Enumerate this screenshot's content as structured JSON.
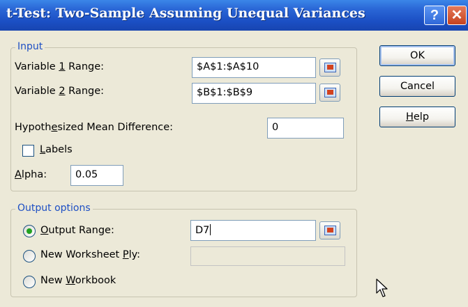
{
  "window": {
    "title": "t-Test: Two-Sample Assuming Unequal Variances",
    "help_glyph": "?",
    "close_glyph": "✕"
  },
  "input": {
    "legend": "Input",
    "var1": {
      "label_pre": "Variable ",
      "label_key": "1",
      "label_post": " Range:",
      "value": "$A$1:$A$10"
    },
    "var2": {
      "label_pre": "Variable ",
      "label_key": "2",
      "label_post": " Range:",
      "value": "$B$1:$B$9"
    },
    "hyp": {
      "label_pre": "Hypoth",
      "label_key": "e",
      "label_post": "sized Mean Difference:",
      "value": "0"
    },
    "labels": {
      "label_pre": "",
      "label_key": "L",
      "label_post": "abels",
      "checked": false
    },
    "alpha": {
      "label_pre": "",
      "label_key": "A",
      "label_post": "lpha:",
      "value": "0.05"
    }
  },
  "output": {
    "legend": "Output options",
    "range": {
      "label_pre": "",
      "label_key": "O",
      "label_post": "utput Range:",
      "value": "D7",
      "selected": true
    },
    "ply": {
      "label_pre": "New Worksheet ",
      "label_key": "P",
      "label_post": "ly:",
      "value": "",
      "selected": false
    },
    "workbook": {
      "label_pre": "New ",
      "label_key": "W",
      "label_post": "orkbook",
      "selected": false
    }
  },
  "buttons": {
    "ok": "OK",
    "cancel": "Cancel",
    "help": {
      "label_pre": "",
      "label_key": "H",
      "label_post": "elp"
    }
  },
  "icons": {
    "range_selector": "collapse-dialog-icon",
    "pointer": "mouse-pointer-icon"
  }
}
